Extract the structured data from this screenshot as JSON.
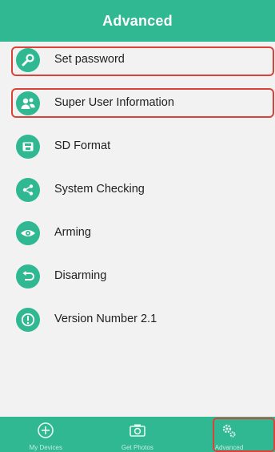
{
  "header": {
    "title": "Advanced"
  },
  "menu": {
    "items": [
      {
        "label": "Set password",
        "icon": "wrench-icon",
        "highlighted": true
      },
      {
        "label": "Super User Information",
        "icon": "users-icon",
        "highlighted": true
      },
      {
        "label": "SD Format",
        "icon": "sd-card-icon",
        "highlighted": false
      },
      {
        "label": "System Checking",
        "icon": "share-nodes-icon",
        "highlighted": false
      },
      {
        "label": "Arming",
        "icon": "eye-icon",
        "highlighted": false
      },
      {
        "label": "Disarming",
        "icon": "undo-icon",
        "highlighted": false
      },
      {
        "label": "Version Number 2.1",
        "icon": "exclamation-icon",
        "highlighted": false
      }
    ]
  },
  "tabbar": {
    "tabs": [
      {
        "label": "My Devices",
        "icon": "plus-circle-icon",
        "active": false
      },
      {
        "label": "Get Photos",
        "icon": "camera-icon",
        "active": false
      },
      {
        "label": "Advanced",
        "icon": "gears-icon",
        "active": true
      }
    ]
  },
  "colors": {
    "accent": "#2fb892",
    "highlight": "#d9443a"
  }
}
